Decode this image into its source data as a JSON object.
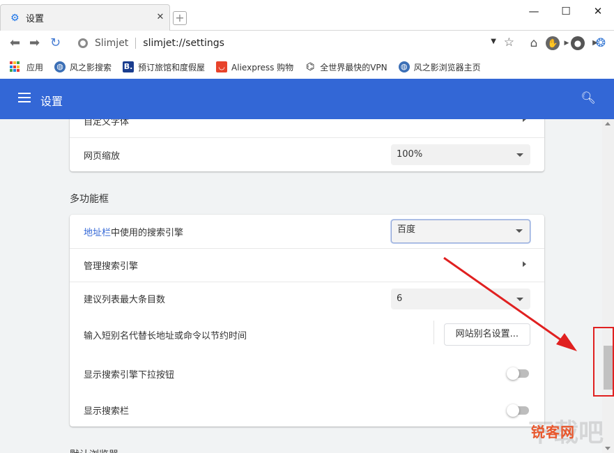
{
  "window": {
    "tab_title": "设置",
    "tab_close": "✕",
    "new_tab": "+",
    "controls": {
      "minimize": "—",
      "maximize": "☐",
      "close": "✕"
    }
  },
  "address_bar": {
    "back": "⬅",
    "forward": "➡",
    "reload": "↻",
    "site_name": "Slimjet",
    "url": "slimjet://settings",
    "dropdown": "▼",
    "star": "☆"
  },
  "bookmarks": [
    {
      "label": "应用",
      "icon": "apps-grid-icon"
    },
    {
      "label": "风之影搜索",
      "icon": "globe-icon"
    },
    {
      "label": "预订旅馆和度假屋",
      "icon": "booking-icon"
    },
    {
      "label": "Aliexpress 购物",
      "icon": "aliexpress-icon"
    },
    {
      "label": "全世界最快的VPN",
      "icon": "tornado-icon"
    },
    {
      "label": "风之影浏览器主页",
      "icon": "globe-icon"
    }
  ],
  "header": {
    "title": "设置"
  },
  "appearance_card": {
    "partial_row_label": "自定义字体",
    "zoom_label": "网页缩放",
    "zoom_value": "100%"
  },
  "omnibox_section": {
    "title": "多功能框",
    "engine_label_link": "地址栏",
    "engine_label_rest": "中使用的搜索引擎",
    "engine_value": "百度",
    "manage_label": "管理搜索引擎",
    "max_suggest_label": "建议列表最大条目数",
    "max_suggest_value": "6",
    "alias_label": "输入短别名代替长地址或命令以节约时间",
    "alias_button": "网站别名设置...",
    "dropdown_button_label": "显示搜索引擎下拉按钮",
    "dropdown_button_enabled": false,
    "search_bar_label": "显示搜索栏",
    "search_bar_enabled": false
  },
  "next_section": {
    "partial_title": "默认浏览器"
  },
  "watermark": {
    "text": "锐客网"
  },
  "colors": {
    "header_blue": "#3367d6",
    "annotation_red": "#e02020"
  }
}
